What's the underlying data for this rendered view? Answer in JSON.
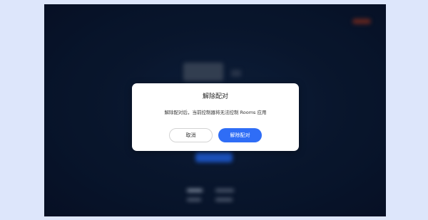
{
  "dialog": {
    "title": "解除配对",
    "message": "解除配对后，当前控制器将无法控制 Rooms 应用",
    "cancel_label": "取消",
    "confirm_label": "解除配对"
  },
  "colors": {
    "page_background": "#dde6fb",
    "screen_background": "#0b1a34",
    "primary_button": "#2f6df6",
    "dialog_background": "#ffffff"
  }
}
